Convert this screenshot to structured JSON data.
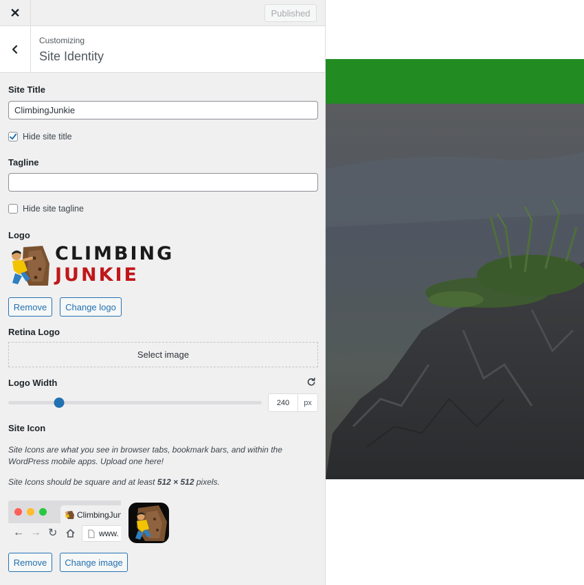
{
  "topbar": {
    "close_icon": "close-icon",
    "publish_label": "Published"
  },
  "header": {
    "breadcrumb": "Customizing",
    "title": "Site Identity",
    "back_icon": "chevron-left-icon"
  },
  "site_title": {
    "label": "Site Title",
    "value": "ClimbingJunkie",
    "hide_label": "Hide site title",
    "hide_checked": true
  },
  "tagline": {
    "label": "Tagline",
    "value": "",
    "hide_label": "Hide site tagline",
    "hide_checked": false
  },
  "logo": {
    "label": "Logo",
    "brand_line1": "CLIMBING",
    "brand_line2": "JUNKIE",
    "brand_color_dark": "#1a1a1a",
    "brand_color_red": "#c0171a",
    "remove_label": "Remove",
    "change_label": "Change logo"
  },
  "retina_logo": {
    "label": "Retina Logo",
    "select_label": "Select image"
  },
  "logo_width": {
    "label": "Logo Width",
    "value": "240",
    "unit": "px",
    "slider_fraction": 0.2,
    "reset_icon": "reset-icon"
  },
  "site_icon": {
    "label": "Site Icon",
    "desc1": "Site Icons are what you see in browser tabs, bookmark bars, and within the WordPress mobile apps. Upload one here!",
    "desc2_prefix": "Site Icons should be square and at least ",
    "desc2_bold": "512 × 512",
    "desc2_suffix": " pixels.",
    "tab_label": "ClimbingJunkie",
    "url_text": "www.",
    "remove_label": "Remove",
    "change_label": "Change image"
  },
  "colors": {
    "accent": "#2271b1",
    "preview_header": "#228b22",
    "sidebar_bg": "#f0f0f1"
  }
}
